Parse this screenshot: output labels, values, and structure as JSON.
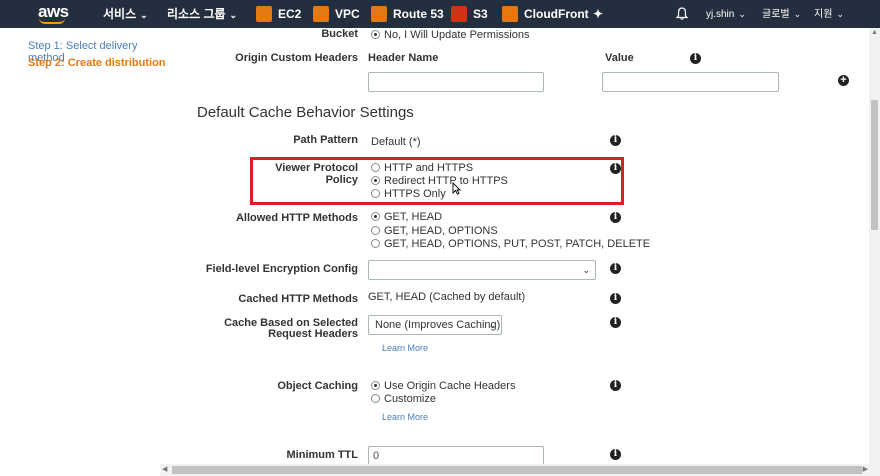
{
  "nav": {
    "logo": "aws",
    "services": "서비스",
    "resource_groups": "리소스 그룹",
    "shortcuts": [
      {
        "label": "EC2",
        "color": "#e47911"
      },
      {
        "label": "VPC",
        "color": "#e47911"
      },
      {
        "label": "Route 53",
        "color": "#e47911"
      },
      {
        "label": "S3",
        "color": "#d13212"
      },
      {
        "label": "CloudFront",
        "color": "#e47911"
      }
    ],
    "user": "yj.shin",
    "region": "글로벌",
    "support": "지원"
  },
  "sidebar": {
    "steps": [
      {
        "label": "Step 1: Select delivery method"
      },
      {
        "label": "Step 2: Create distribution"
      }
    ]
  },
  "form": {
    "bucket": {
      "label": "Bucket",
      "option": "No, I Will Update Permissions"
    },
    "origin_headers": {
      "label": "Origin Custom Headers",
      "col_name": "Header Name",
      "col_value": "Value"
    },
    "section_title": "Default Cache Behavior Settings",
    "path_pattern": {
      "label": "Path Pattern",
      "value": "Default (*)"
    },
    "viewer_protocol": {
      "label": "Viewer Protocol Policy",
      "options": [
        "HTTP and HTTPS",
        "Redirect HTTP to HTTPS",
        "HTTPS Only"
      ],
      "selected": "Redirect HTTP to HTTPS"
    },
    "allowed_methods": {
      "label": "Allowed HTTP Methods",
      "options": [
        "GET, HEAD",
        "GET, HEAD, OPTIONS",
        "GET, HEAD, OPTIONS, PUT, POST, PATCH, DELETE"
      ],
      "selected": "GET, HEAD"
    },
    "field_encryption": {
      "label": "Field-level Encryption Config",
      "value": ""
    },
    "cached_methods": {
      "label": "Cached HTTP Methods",
      "value": "GET, HEAD (Cached by default)"
    },
    "cache_headers": {
      "label_line1": "Cache Based on Selected",
      "label_line2": "Request Headers",
      "value": "None (Improves Caching)",
      "learn_more": "Learn More"
    },
    "object_caching": {
      "label": "Object Caching",
      "options": [
        "Use Origin Cache Headers",
        "Customize"
      ],
      "selected": "Use Origin Cache Headers",
      "learn_more": "Learn More"
    },
    "min_ttl": {
      "label": "Minimum TTL",
      "value": "0"
    }
  },
  "colors": {
    "nav_bg": "#232f3e",
    "highlight": "#e31b23",
    "active_step": "#e47911",
    "link": "#4a7db8"
  }
}
